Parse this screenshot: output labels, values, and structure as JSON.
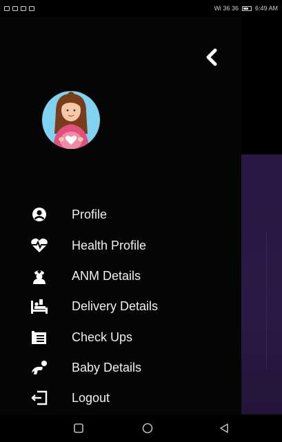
{
  "status_bar": {
    "time": "6:49 AM",
    "network": "Wi 36 36"
  },
  "drawer": {
    "back_icon": "chevron-left-icon",
    "menu": [
      {
        "label": "Profile",
        "icon": "person-icon"
      },
      {
        "label": "Health Profile",
        "icon": "heart-pulse-icon"
      },
      {
        "label": "ANM Details",
        "icon": "nurse-icon"
      },
      {
        "label": "Delivery Details",
        "icon": "hospital-bed-icon"
      },
      {
        "label": "Check Ups",
        "icon": "clipboard-icon"
      },
      {
        "label": "Baby Details",
        "icon": "baby-crawl-icon"
      },
      {
        "label": "Logout",
        "icon": "logout-icon"
      }
    ]
  },
  "nav_bar": {
    "items": [
      "recents-button",
      "home-button",
      "back-button"
    ]
  },
  "colors": {
    "background": "#050505",
    "avatar_bg": "#7fd3f0",
    "accent": "#e2517a",
    "content_purple": "#2a1642"
  }
}
